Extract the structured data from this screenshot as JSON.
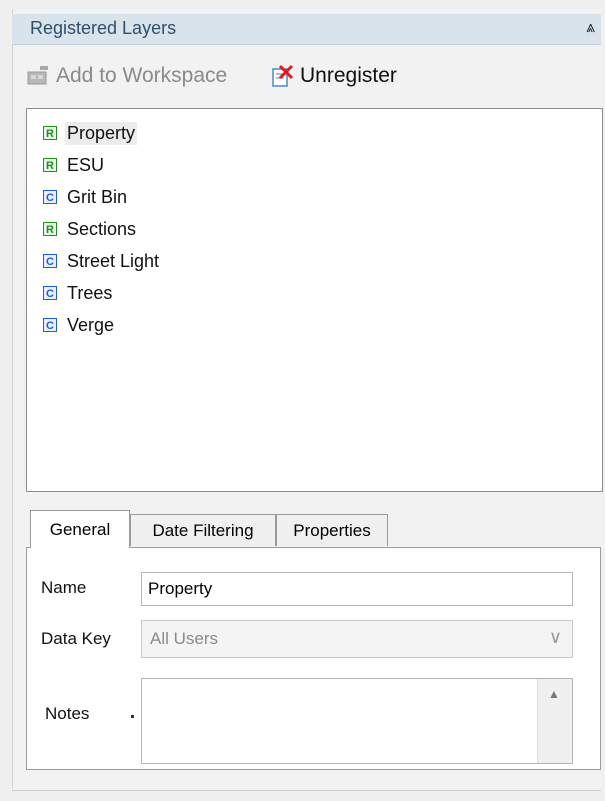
{
  "panel": {
    "title": "Registered Layers",
    "pin_icon": "pin-icon"
  },
  "toolbar": {
    "add_label": "Add to Workspace",
    "unregister_label": "Unregister"
  },
  "layers": [
    {
      "badge": "R",
      "label": "Property",
      "selected": true
    },
    {
      "badge": "R",
      "label": "ESU"
    },
    {
      "badge": "C",
      "label": "Grit Bin"
    },
    {
      "badge": "R",
      "label": "Sections"
    },
    {
      "badge": "C",
      "label": "Street Light"
    },
    {
      "badge": "C",
      "label": "Trees"
    },
    {
      "badge": "C",
      "label": "Verge"
    }
  ],
  "tabs": [
    {
      "label": "General",
      "active": true
    },
    {
      "label": "Date Filtering"
    },
    {
      "label": "Properties"
    }
  ],
  "form": {
    "name_label": "Name",
    "name_value": "Property",
    "datakey_label": "Data Key",
    "datakey_value": "All Users",
    "notes_label": "Notes"
  },
  "colors": {
    "badge_r": "#1e8f1e",
    "badge_c": "#1e5fd6",
    "title_bar": "#d8e3ec"
  }
}
